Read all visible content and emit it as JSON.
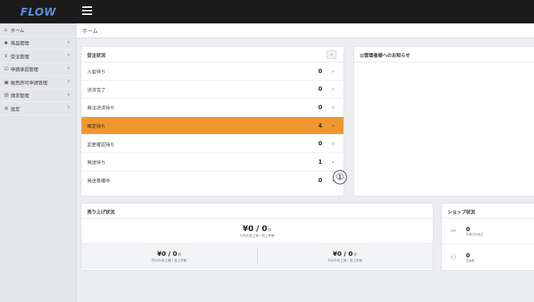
{
  "app": {
    "logo": "FLOW",
    "menu_icon": "hamburger-icon"
  },
  "sidebar": {
    "items": [
      {
        "icon": "home-icon",
        "glyph": "⌂",
        "label": "ホーム",
        "has_chevron": false
      },
      {
        "icon": "tag-icon",
        "glyph": "◆",
        "label": "商品管理",
        "has_chevron": true
      },
      {
        "icon": "cart-icon",
        "glyph": "⊻",
        "label": "受注管理",
        "has_chevron": true
      },
      {
        "icon": "check-box-icon",
        "glyph": "☑",
        "label": "申請承認管理",
        "has_chevron": true
      },
      {
        "icon": "store-icon",
        "glyph": "▣",
        "label": "販売許可申請管理",
        "has_chevron": true
      },
      {
        "icon": "invoice-icon",
        "glyph": "▤",
        "label": "請求管理",
        "has_chevron": true
      },
      {
        "icon": "gear-icon",
        "glyph": "⚙",
        "label": "設定",
        "has_chevron": true
      }
    ]
  },
  "breadcrumb": "ホーム",
  "orders": {
    "title": "受注状況",
    "header_button": "›",
    "rows": [
      {
        "label": "入金待ち",
        "count": "0",
        "active": false
      },
      {
        "label": "決済完了",
        "count": "0",
        "active": false
      },
      {
        "label": "発注決済待ち",
        "count": "0",
        "active": false
      },
      {
        "label": "確定待ち",
        "count": "4",
        "active": true
      },
      {
        "label": "変更確認待ち",
        "count": "0",
        "active": false
      },
      {
        "label": "発送待ち",
        "count": "1",
        "active": false
      },
      {
        "label": "発送準備中",
        "count": "0",
        "active": false
      }
    ],
    "arrow": "›"
  },
  "annotation_marker": "①",
  "notice": {
    "title": "▥管理者様へのお知らせ"
  },
  "sales": {
    "title": "売り上げ状況",
    "month": {
      "value": "¥0 / 0",
      "unit": "件",
      "label": "今月の売上額 / 売上件数"
    },
    "yesterday": {
      "value": "¥0 / 0",
      "unit": "件",
      "label": "昨日の売上額 / 売上件数"
    },
    "today": {
      "value": "¥0 / 0",
      "unit": "件",
      "label": "今日の売上額 / 売上件数"
    }
  },
  "shop": {
    "title": "ショップ状況",
    "items": [
      {
        "icon": "no-stock-icon",
        "glyph": "✂",
        "value": "0",
        "label": "在庫切れ商品"
      },
      {
        "icon": "members-icon",
        "glyph": "⚇",
        "value": "0",
        "label": "会員数"
      }
    ]
  }
}
